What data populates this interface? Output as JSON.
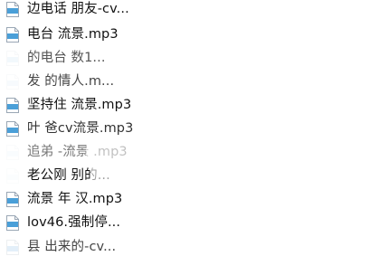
{
  "file_list": {
    "icon": "mp3-audio-file-icon",
    "icon_color": "#4a9fd8",
    "items": [
      {
        "name": "边电话    朋友-cv..."
      },
      {
        "name": "电台    流景.mp3"
      },
      {
        "name": "    的电台    数1..."
      },
      {
        "name": "发    的情人.m..."
      },
      {
        "name": "坚持住    流景.mp3"
      },
      {
        "name": "叶    爸cv流景.mp3"
      },
      {
        "name": "追弟    -流景    .mp3"
      },
      {
        "name": "老公刚    别的..."
      },
      {
        "name": "流景    年    汉.mp3"
      },
      {
        "name": "    lov46.强制停..."
      },
      {
        "name": "    县    出来的-cv..."
      }
    ]
  }
}
